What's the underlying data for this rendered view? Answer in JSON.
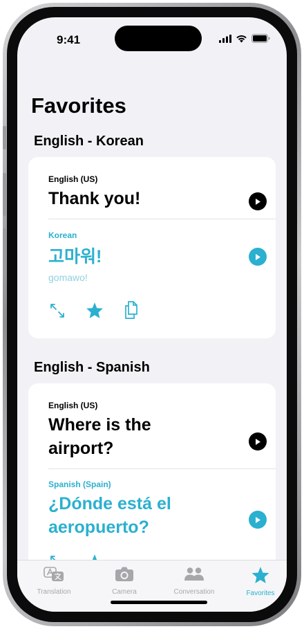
{
  "status_bar": {
    "time": "9:41"
  },
  "page": {
    "title": "Favorites"
  },
  "sections": [
    {
      "heading": "English - Korean",
      "source_label": "English (US)",
      "source_text": "Thank you!",
      "target_label": "Korean",
      "target_text": "고마워!",
      "romanization": "gomawo!"
    },
    {
      "heading": "English - Spanish",
      "source_label": "English (US)",
      "source_text_lines": [
        "Where is the",
        "airport?"
      ],
      "target_label": "Spanish (Spain)",
      "target_text_lines": [
        "¿Dónde está el",
        "aeropuerto?"
      ]
    }
  ],
  "tab_bar": {
    "items": [
      {
        "label": "Translation",
        "icon": "translate-icon"
      },
      {
        "label": "Camera",
        "icon": "camera-icon"
      },
      {
        "label": "Conversation",
        "icon": "people-icon"
      },
      {
        "label": "Favorites",
        "icon": "star-icon"
      }
    ],
    "active": "Favorites"
  },
  "colors": {
    "accent": "#2bb0cf",
    "background": "#f2f2f6",
    "card": "#ffffff",
    "romanization": "#8fd1e2",
    "tab_inactive": "#a7a7ab"
  }
}
